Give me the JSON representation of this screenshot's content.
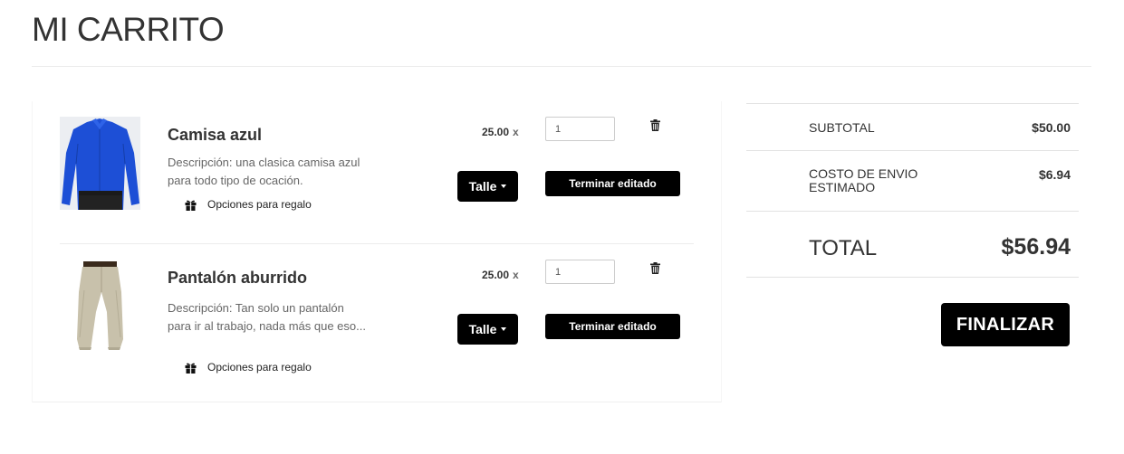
{
  "page": {
    "title": "MI CARRITO"
  },
  "cart": {
    "items": [
      {
        "name": "Camisa azul",
        "description": "Descripción: una clasica camisa azul para todo tipo de ocación.",
        "gift_label": "Opciones para regalo",
        "price": "25.00",
        "price_multiplier": "x",
        "quantity": "1",
        "size_label": "Talle",
        "done_label": "Terminar editado",
        "image_icon": "blue-shirt-image",
        "colors": {
          "product": "#1a4fd8"
        }
      },
      {
        "name": "Pantalón aburrido",
        "description": "Descripción: Tan solo un pantalón para ir al trabajo, nada más que eso...",
        "gift_label": "Opciones para regalo",
        "price": "25.00",
        "price_multiplier": "x",
        "quantity": "1",
        "size_label": "Talle",
        "done_label": "Terminar editado",
        "image_icon": "khaki-pants-image",
        "colors": {
          "product": "#c9c2ad"
        }
      }
    ]
  },
  "summary": {
    "subtotal_label": "SUBTOTAL",
    "subtotal_value": "$50.00",
    "shipping_label": "COSTO DE ENVIO ESTIMADO",
    "shipping_value": "$6.94",
    "total_label": "TOTAL",
    "total_value": "$56.94",
    "checkout_label": "FINALIZAR"
  },
  "colors": {
    "button_bg": "#000000",
    "text": "#333333",
    "muted_text": "#666666"
  }
}
